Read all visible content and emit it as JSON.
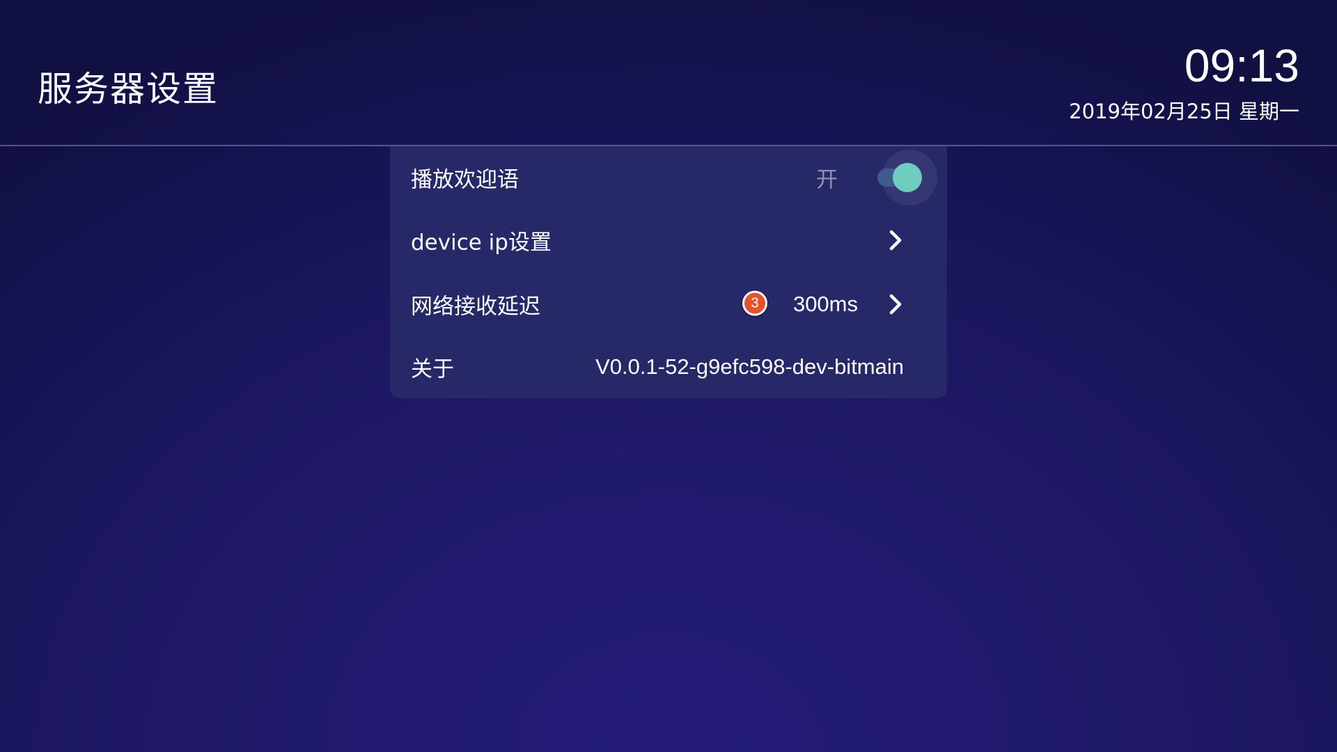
{
  "header": {
    "title": "服务器设置",
    "time": "09:13",
    "date": "2019年02月25日  星期一"
  },
  "settings": {
    "items": [
      {
        "label": "播放欢迎语",
        "state_text": "开",
        "toggle_on": true
      },
      {
        "label": "device ip设置",
        "icon": "chevron-right-icon"
      },
      {
        "label": "网络接收延迟",
        "badge": "3",
        "value": "300ms",
        "icon": "chevron-right-icon"
      },
      {
        "label": "关于",
        "value": "V0.0.1-52-g9efc598-dev-bitmain"
      }
    ]
  },
  "colors": {
    "background": "#1b175e",
    "panel": "#262868",
    "toggle_thumb": "#6fcdbf",
    "toggle_track": "#3f5a8c",
    "badge": "#e2532e"
  }
}
